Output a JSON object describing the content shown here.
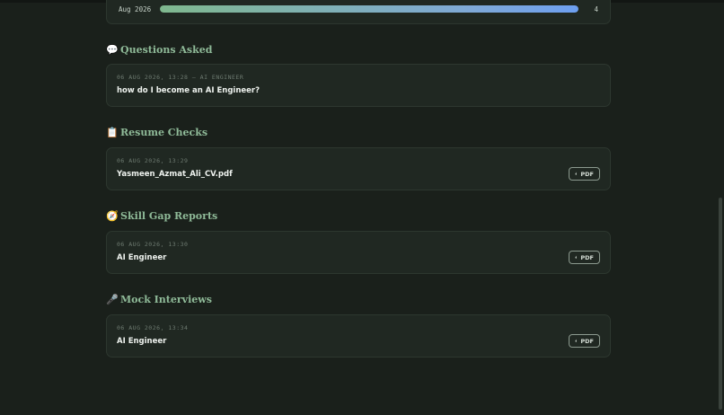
{
  "activity": {
    "month": "Aug 2026",
    "count": "4",
    "fill_fraction": 1.0
  },
  "sections": {
    "questions": {
      "emoji": "💬",
      "title": "Questions Asked",
      "entry": {
        "meta": "06 AUG 2026, 13:28 — AI ENGINEER",
        "title": "how do I become an AI Engineer?"
      }
    },
    "resume": {
      "emoji": "📋",
      "title": "Resume Checks",
      "entry": {
        "meta": "06 AUG 2026, 13:29",
        "title": "Yasmeen_Azmat_Ali_CV.pdf",
        "button": "PDF"
      }
    },
    "skillgap": {
      "emoji": "🧭",
      "title": "Skill Gap Reports",
      "entry": {
        "meta": "06 AUG 2026, 13:30",
        "title": "AI Engineer",
        "button": "PDF"
      }
    },
    "interviews": {
      "emoji": "🎤",
      "title": "Mock Interviews",
      "entry": {
        "meta": "06 AUG 2026, 13:34",
        "title": "AI Engineer",
        "button": "PDF"
      }
    }
  },
  "icons": {
    "download": "download-arrow-icon"
  },
  "colors": {
    "background": "#1a201b",
    "card": "#202822",
    "heading": "#8fba98",
    "bar_start": "#7fb88e",
    "bar_end": "#6d9ff0"
  }
}
